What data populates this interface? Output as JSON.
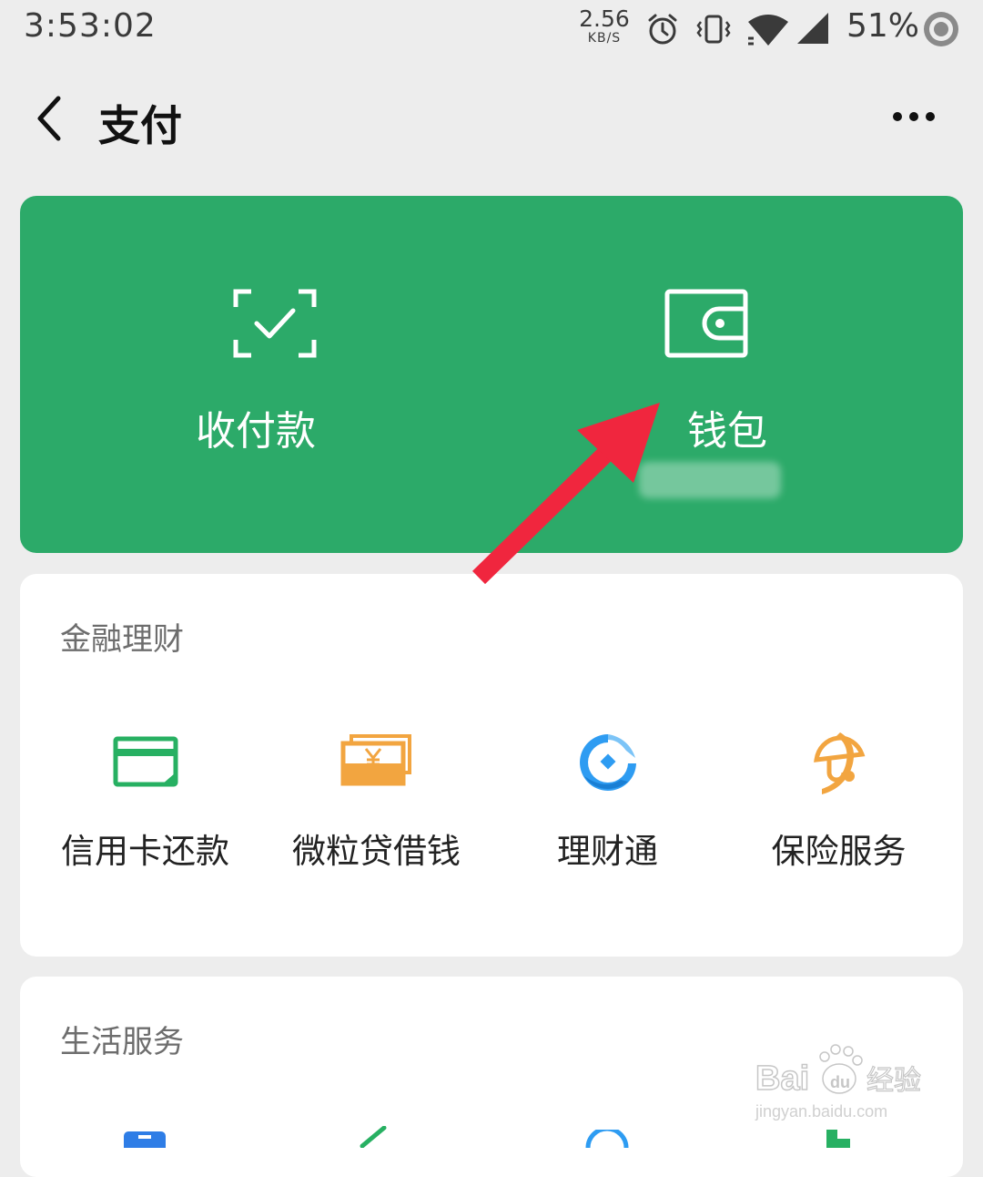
{
  "status_bar": {
    "time": "3:53:02",
    "net_speed_value": "2.56",
    "net_speed_unit": "KB/S",
    "battery": "51%",
    "icons": [
      "alarm-icon",
      "vibrate-icon",
      "wifi-icon",
      "signal-icon",
      "battery-ring-icon"
    ]
  },
  "nav": {
    "title": "支付",
    "back_icon": "chevron-left-icon",
    "more_icon": "more-dots-icon"
  },
  "pay_card": {
    "color": "#2caa69",
    "receive": {
      "label": "收付款",
      "icon": "scan-check-icon"
    },
    "wallet": {
      "label": "钱包",
      "icon": "wallet-icon"
    }
  },
  "finance": {
    "title": "金融理财",
    "items": [
      {
        "label": "信用卡还款",
        "icon": "credit-card-icon",
        "color": "#27b062"
      },
      {
        "label": "微粒贷借钱",
        "icon": "cash-yuan-icon",
        "color": "#f2a540"
      },
      {
        "label": "理财通",
        "icon": "licaitong-icon",
        "color": "#2e9cf2"
      },
      {
        "label": "保险服务",
        "icon": "insurance-umbrella-icon",
        "color": "#f2a540"
      }
    ]
  },
  "life": {
    "title": "生活服务"
  },
  "annotation": {
    "arrow_color": "#f0263e",
    "icon": "arrow-annotation-icon"
  },
  "watermark": {
    "brand": "Bai du 经验",
    "url": "jingyan.baidu.com"
  }
}
